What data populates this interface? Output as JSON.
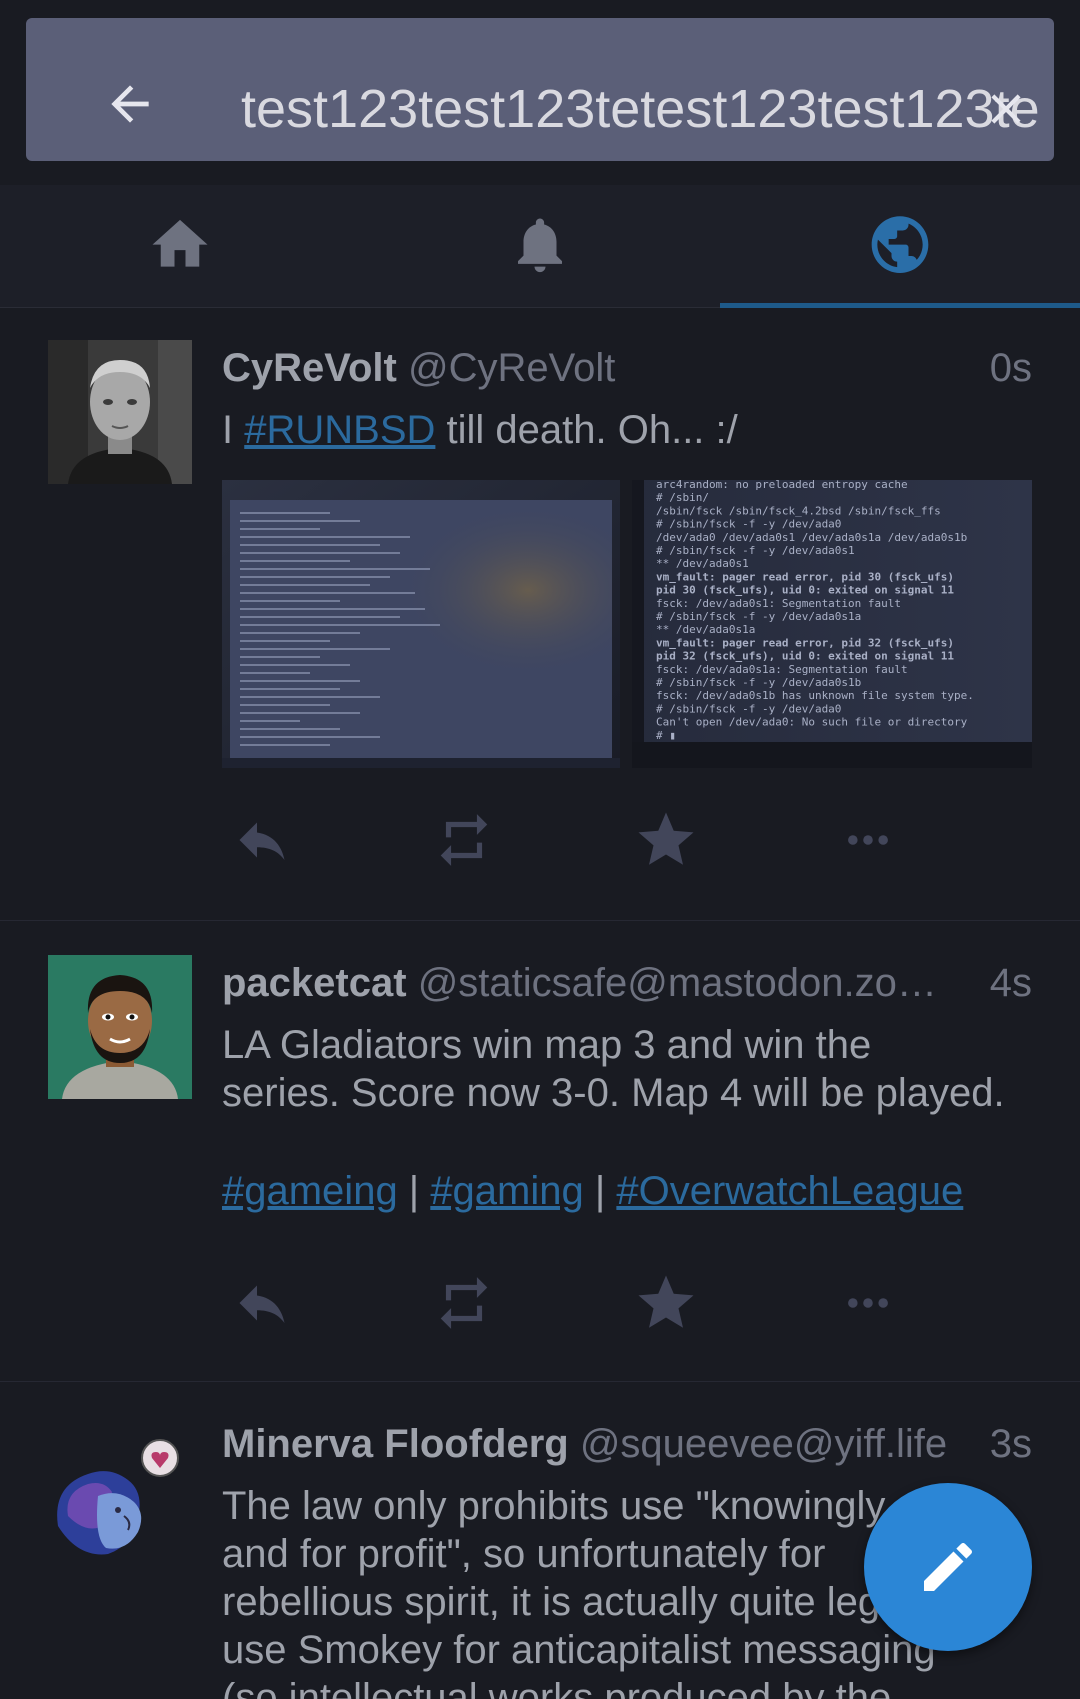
{
  "search": {
    "query": "test123test123tetest123test123te",
    "back_icon": "arrow-left-icon",
    "clear_icon": "close-icon"
  },
  "tabs": [
    {
      "icon": "home-icon",
      "active": false
    },
    {
      "icon": "bell-icon",
      "active": false
    },
    {
      "icon": "globe-icon",
      "active": true
    }
  ],
  "colors": {
    "background": "#191b22",
    "search_bar": "#5b5f78",
    "accent": "#2b86d6",
    "hashtag": "#2b6a9e",
    "tab_indicator": "#1e5a8a"
  },
  "statuses": [
    {
      "display_name": "CyReVolt",
      "acct": "@CyReVolt",
      "time": "0s",
      "content": {
        "before": "I ",
        "hashtag": "#RUNBSD",
        "after": " till death. Oh... :/"
      },
      "media": [
        {
          "lines": []
        },
        {
          "lines": [
            "arc4random: no preloaded entropy cache",
            "# /sbin/",
            "/sbin/fsck          /sbin/fsck_4.2bsd  /sbin/fsck_ffs",
            "# /sbin/fsck -f -y /dev/ada0",
            "/dev/ada0    /dev/ada0s1  /dev/ada0s1a /dev/ada0s1b",
            "# /sbin/fsck -f -y /dev/ada0s1",
            "** /dev/ada0s1",
            "vm_fault: pager read error, pid 30 (fsck_ufs)",
            "pid 30 (fsck_ufs), uid 0: exited on signal 11",
            "fsck: /dev/ada0s1: Segmentation fault",
            "# /sbin/fsck -f -y /dev/ada0s1a",
            "** /dev/ada0s1a",
            "vm_fault: pager read error, pid 32 (fsck_ufs)",
            "pid 32 (fsck_ufs), uid 0: exited on signal 11",
            "fsck: /dev/ada0s1a: Segmentation fault",
            "# /sbin/fsck -f -y /dev/ada0s1b",
            "fsck: /dev/ada0s1b has unknown file system type.",
            "# /sbin/fsck -f -y /dev/ada0",
            "Can't open /dev/ada0: No such file or directory",
            "# ▮"
          ]
        }
      ],
      "actions": [
        "reply-icon",
        "boost-icon",
        "star-icon",
        "more-icon"
      ]
    },
    {
      "display_name": "packetcat",
      "acct": "@staticsafe@mastodon.zo…",
      "time": "4s",
      "content": {
        "line1": "LA Gladiators win map 3 and win the",
        "line2": "series. Score now 3-0. Map 4 will be played.",
        "tags": [
          "#gameing",
          "#gaming",
          "#OverwatchLeague"
        ],
        "sep": " | "
      },
      "actions": [
        "reply-icon",
        "boost-icon",
        "star-icon",
        "more-icon"
      ]
    },
    {
      "display_name": "Minerva Floofderg",
      "acct": "@squeevee@yiff.life",
      "time": "3s",
      "content": {
        "lines": [
          "The law only prohibits use \"knowingly",
          "and for profit\", so unfortunately for",
          "rebellious spirit, it is actually quite legal to",
          "use Smokey for anticapitalist messaging",
          "(so intellectual works produced by the"
        ]
      }
    }
  ],
  "fab": {
    "icon": "pencil-icon"
  }
}
